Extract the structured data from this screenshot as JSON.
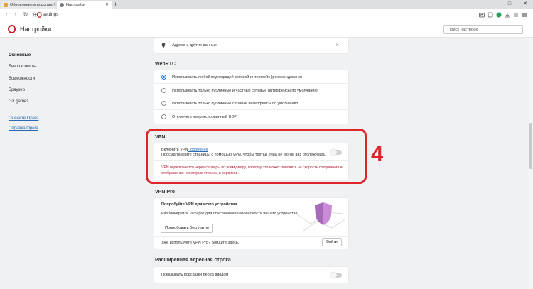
{
  "browser": {
    "tabs": [
      {
        "label": "Обновление и восстано",
        "active": false
      },
      {
        "label": "Настройки",
        "active": true
      }
    ],
    "new_tab": "+",
    "window_controls": {
      "minimize": "–",
      "maximize": "□",
      "close": "✕"
    },
    "url": "settings"
  },
  "header": {
    "title": "Настройки",
    "search_placeholder": "Поиск настроек"
  },
  "sidebar": {
    "items": [
      {
        "label": "Основные",
        "selected": true
      },
      {
        "label": "Безопасность",
        "selected": false
      },
      {
        "label": "Возможности",
        "selected": false
      },
      {
        "label": "Браузер",
        "selected": false
      },
      {
        "label": "GX.games",
        "selected": false
      }
    ],
    "links": [
      "Оцените Opera",
      "Справка Opera"
    ]
  },
  "address_row": {
    "label": "Адреса и другие данные"
  },
  "webrtc": {
    "title": "WebRTC",
    "options": [
      {
        "label": "Использовать любой подходящий сетевой интерфейс (рекомендовано)",
        "selected": true
      },
      {
        "label": "Использовать только публичные и частные сетевые интерфейсы по умолчанию",
        "selected": false
      },
      {
        "label": "Использовать только публичные сетевые интерфейсы по умолчанию",
        "selected": false
      },
      {
        "label": "Отключить непроксированный UDP",
        "selected": false
      }
    ]
  },
  "vpn": {
    "title": "VPN",
    "enable_label": "Включить VPN",
    "more_link": "Подробнее",
    "description": "Просматривайте страницы с помощью VPN, чтобы третьи лица не могли вас отслеживать.",
    "warning": "VPN подключается через серверы по всему миру, поэтому это может повлиять на скорость соединения и отображение некоторых страниц и сервисов.",
    "enabled": false
  },
  "vpn_pro": {
    "title": "VPN Pro",
    "promo_title": "Попробуйте VPN для всего устройства",
    "promo_text": "Разблокируйте VPN pro для обеспечения безопасности вашего устройства",
    "try_button": "Попробовать бесплатно",
    "already_text": "Уже используете VPN Pro? Войдите здесь.",
    "login_button": "Войти"
  },
  "address_bar": {
    "title": "Расширенная адресная строка",
    "hints_label": "Показывать подсказки перед вводом",
    "hints_enabled": false
  },
  "annotation": {
    "number": "4"
  },
  "colors": {
    "accent": "#1a73e8",
    "brand": "#d11d27",
    "annotation": "#e0242b",
    "warning": "#b0243a"
  }
}
